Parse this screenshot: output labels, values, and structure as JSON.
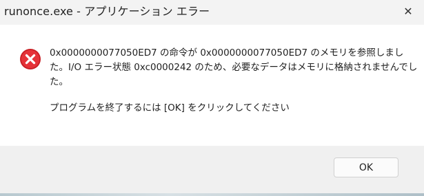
{
  "window": {
    "title": "runonce.exe - アプリケーション エラー",
    "close_icon": "close-icon"
  },
  "dialog": {
    "icon": "error-icon",
    "message": "0x0000000077050ED7 の命令が 0x0000000077050ED7 のメモリを参照しました。I/O エラー状態 0xc0000242 のため、必要なデータはメモリに格納されませんでした。",
    "prompt": "プログラムを終了するには [OK] をクリックしてください"
  },
  "buttons": {
    "ok_label": "OK"
  },
  "colors": {
    "error_red": "#d8232a",
    "content_bg": "#ffffff",
    "footer_bg": "#f0f0f0"
  }
}
